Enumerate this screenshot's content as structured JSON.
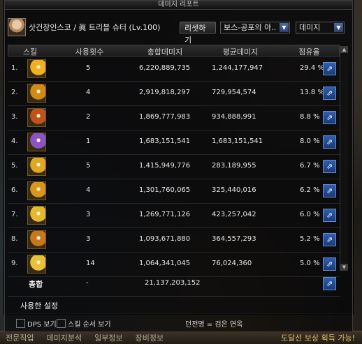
{
  "window": {
    "title": "데미지 리포트"
  },
  "header": {
    "character": "삿건장인스코 / 眞 트리블 슈터 (Lv.100)",
    "reset_label": "리셋하기",
    "dungeon_select": "보스-공포의 아..",
    "mode_select": "데미지"
  },
  "columns": [
    "스킬",
    "사용횟수",
    "총합데미지",
    "평균데미지",
    "점유율"
  ],
  "rows": [
    {
      "idx": "1.",
      "count": "5",
      "total": "6,220,889,735",
      "avg": "1,244,177,947",
      "share": "29.4 %",
      "color": "#f0b020"
    },
    {
      "idx": "2.",
      "count": "4",
      "total": "2,919,818,297",
      "avg": "729,954,574",
      "share": "13.8 %",
      "color": "#d28a16"
    },
    {
      "idx": "3.",
      "count": "2",
      "total": "1,869,777,983",
      "avg": "934,888,991",
      "share": "8.8 %",
      "color": "#c0521c"
    },
    {
      "idx": "4.",
      "count": "1",
      "total": "1,683,151,541",
      "avg": "1,683,151,541",
      "share": "8.0 %",
      "color": "#8c52c8"
    },
    {
      "idx": "5.",
      "count": "5",
      "total": "1,415,949,776",
      "avg": "283,189,955",
      "share": "6.7 %",
      "color": "#e0a822"
    },
    {
      "idx": "6.",
      "count": "4",
      "total": "1,301,760,065",
      "avg": "325,440,016",
      "share": "6.2 %",
      "color": "#d8961c"
    },
    {
      "idx": "7.",
      "count": "3",
      "total": "1,269,771,126",
      "avg": "423,257,042",
      "share": "6.0 %",
      "color": "#e6b82a"
    },
    {
      "idx": "8.",
      "count": "3",
      "total": "1,093,671,880",
      "avg": "364,557,293",
      "share": "5.2 %",
      "color": "#c8781a"
    },
    {
      "idx": "9.",
      "count": "14",
      "total": "1,064,341,045",
      "avg": "76,024,360",
      "share": "5.0 %",
      "color": "#eac038"
    }
  ],
  "total": {
    "label": "총합",
    "count": "-",
    "sum": "21,137,203,152"
  },
  "settings": {
    "title": "사용한 설정",
    "dps_label": "DPS 보기",
    "order_label": "스킬 순서 보기",
    "status": "던전명 = 검은 연옥"
  },
  "background_bar": [
    "전문직업",
    "데미지분석",
    "일부정보",
    "장비정보",
    "도달선 보상 획득 가능!"
  ],
  "share_icon": "share-arrow-icon"
}
